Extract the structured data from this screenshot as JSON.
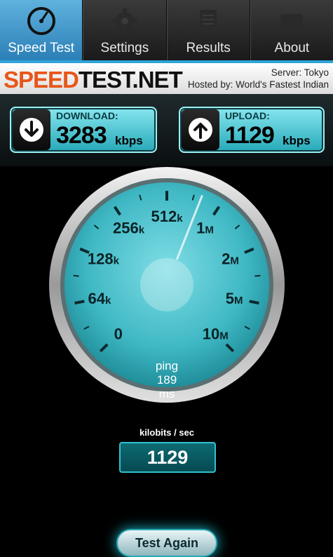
{
  "tabs": [
    {
      "label": "Speed Test",
      "icon": "speedometer-icon",
      "active": true
    },
    {
      "label": "Settings",
      "icon": "gear-icon",
      "active": false
    },
    {
      "label": "Results",
      "icon": "document-icon",
      "active": false
    },
    {
      "label": "About",
      "icon": "info-icon",
      "active": false
    }
  ],
  "brand": {
    "part1": "SPEED",
    "part2": "TEST.NET"
  },
  "server": {
    "line1": "Server: Tokyo",
    "line2": "Hosted by: World's Fastest Indian"
  },
  "download": {
    "label": "DOWNLOAD:",
    "value": "3283",
    "unit": "kbps",
    "icon": "arrow-down-icon"
  },
  "upload": {
    "label": "UPLOAD:",
    "value": "1129",
    "unit": "kbps",
    "icon": "arrow-up-icon"
  },
  "gauge": {
    "scale_labels": [
      {
        "num": "0",
        "suffix": ""
      },
      {
        "num": "64",
        "suffix": "k"
      },
      {
        "num": "128",
        "suffix": "k"
      },
      {
        "num": "256",
        "suffix": "k"
      },
      {
        "num": "512",
        "suffix": "k"
      },
      {
        "num": "1",
        "suffix": "M"
      },
      {
        "num": "2",
        "suffix": "M"
      },
      {
        "num": "5",
        "suffix": "M"
      },
      {
        "num": "10",
        "suffix": "M"
      }
    ],
    "needle_position": 0.58,
    "units_label": "kilobits / sec",
    "readout": "1129"
  },
  "ping": {
    "label": "ping",
    "value": "189",
    "unit": "ms"
  },
  "actions": {
    "test_again": "Test Again"
  },
  "colors": {
    "accent": "#2fa4d8",
    "brand_orange": "#e8551a",
    "dial": "#3fb8c4"
  }
}
